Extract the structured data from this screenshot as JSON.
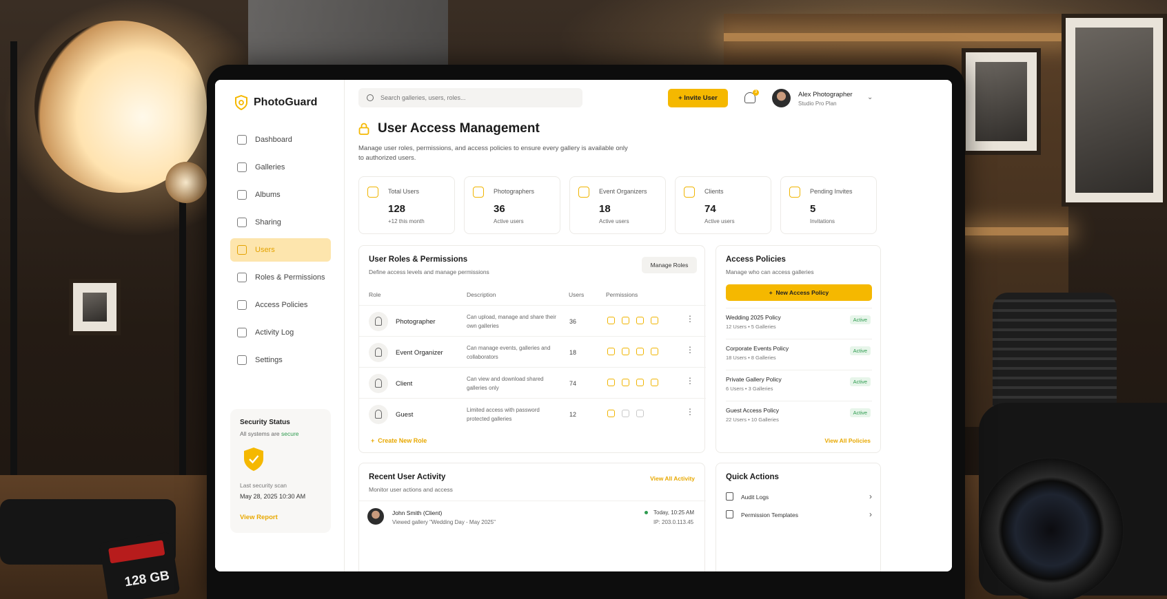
{
  "app": {
    "name": "PhotoGuard"
  },
  "sidebar": {
    "items": [
      {
        "label": "Dashboard",
        "icon": "home-icon"
      },
      {
        "label": "Galleries",
        "icon": "gallery-icon"
      },
      {
        "label": "Albums",
        "icon": "album-icon"
      },
      {
        "label": "Sharing",
        "icon": "share-icon"
      },
      {
        "label": "Users",
        "icon": "users-icon",
        "active": true
      },
      {
        "label": "Roles & Permissions",
        "icon": "roles-icon"
      },
      {
        "label": "Access Policies",
        "icon": "policy-icon"
      },
      {
        "label": "Activity Log",
        "icon": "clock-icon"
      },
      {
        "label": "Settings",
        "icon": "gear-icon"
      }
    ],
    "security": {
      "title": "Security Status",
      "status_prefix": "All systems are",
      "status_value": "secure",
      "last_scan_label": "Last security scan",
      "last_scan_date": "May 28, 2025 10:30 AM",
      "view_report": "View Report"
    }
  },
  "header": {
    "search_placeholder": "Search galleries, users, roles...",
    "invite_label": "Invite User",
    "notification_count": "3",
    "user_name": "Alex Photographer",
    "user_plan": "Studio Pro Plan"
  },
  "page": {
    "title": "User Access Management",
    "description": "Manage user roles, permissions, and access policies to ensure every gallery is available only to authorized users."
  },
  "stats": [
    {
      "label": "Total Users",
      "value": "128",
      "sub": "+12 this month"
    },
    {
      "label": "Photographers",
      "value": "36",
      "sub": "Active users"
    },
    {
      "label": "Event Organizers",
      "value": "18",
      "sub": "Active users"
    },
    {
      "label": "Clients",
      "value": "74",
      "sub": "Active users"
    },
    {
      "label": "Pending Invites",
      "value": "5",
      "sub": "Invitations"
    }
  ],
  "roles": {
    "title": "User Roles & Permissions",
    "subtitle": "Define access levels and manage permissions",
    "manage_label": "Manage Roles",
    "columns": [
      "Role",
      "Description",
      "Users",
      "Permissions"
    ],
    "rows": [
      {
        "name": "Photographer",
        "description": "Can upload, manage and share their own galleries",
        "users": "36"
      },
      {
        "name": "Event Organizer",
        "description": "Can manage events, galleries and collaborators",
        "users": "18"
      },
      {
        "name": "Client",
        "description": "Can view and download shared galleries only",
        "users": "74"
      },
      {
        "name": "Guest",
        "description": "Limited access with password protected galleries",
        "users": "12"
      }
    ],
    "create_label": "Create New Role"
  },
  "policies": {
    "title": "Access Policies",
    "subtitle": "Manage who can access galleries",
    "new_label": "New Access Policy",
    "items": [
      {
        "name": "Wedding 2025 Policy",
        "stats": "12 Users • 5 Galleries",
        "status": "Active"
      },
      {
        "name": "Corporate Events Policy",
        "stats": "18 Users • 8 Galleries",
        "status": "Active"
      },
      {
        "name": "Private Gallery Policy",
        "stats": "6 Users • 3 Galleries",
        "status": "Active"
      },
      {
        "name": "Guest Access Policy",
        "stats": "22 Users • 10 Galleries",
        "status": "Active"
      }
    ],
    "view_all": "View All Policies"
  },
  "activity": {
    "title": "Recent User Activity",
    "subtitle": "Monitor user actions and access",
    "view_all": "View All Activity",
    "items": [
      {
        "name": "John Smith (Client)",
        "action": "Viewed gallery \"Wedding Day - May 2025\"",
        "time": "Today, 10:25 AM",
        "ip": "IP: 203.0.113.45"
      }
    ]
  },
  "quick_actions": {
    "title": "Quick Actions",
    "items": [
      {
        "label": "Audit Logs"
      },
      {
        "label": "Permission Templates"
      }
    ]
  },
  "desk": {
    "sd_card": "128 GB"
  },
  "colors": {
    "accent": "#f5b800",
    "active_bg": "#fde5ad",
    "success": "#2e9b4f"
  }
}
